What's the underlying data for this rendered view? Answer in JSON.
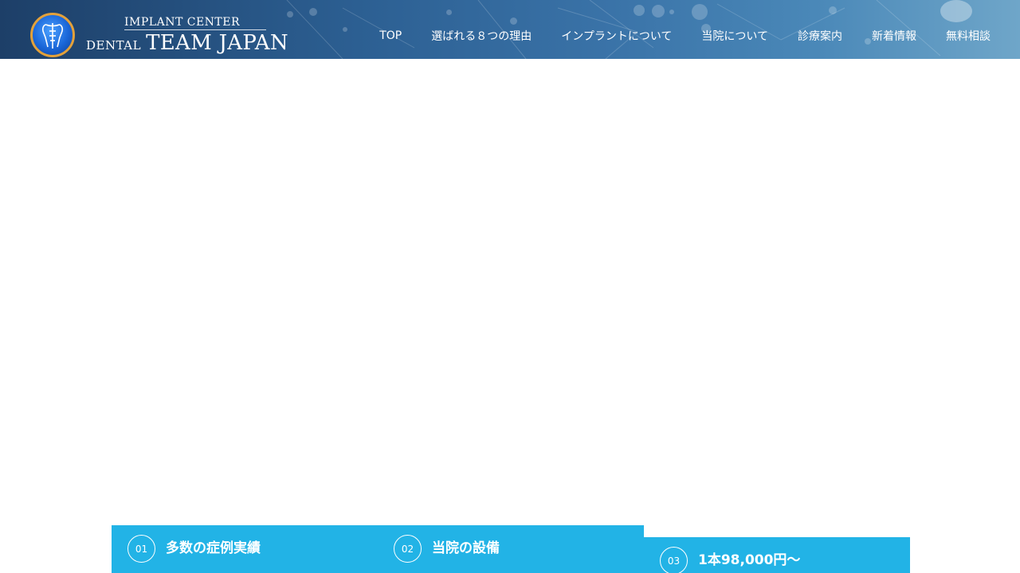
{
  "brand": {
    "small": "IMPLANT CENTER",
    "dental": "DENTAL",
    "name": "TEAM JAPAN",
    "logo_icon": "tooth-implant-emblem-icon"
  },
  "nav": {
    "items": [
      {
        "label": "TOP"
      },
      {
        "label": "選ばれる８つの理由"
      },
      {
        "label": "インプラントについて"
      },
      {
        "label": "当院について"
      },
      {
        "label": "診療案内"
      },
      {
        "label": "新着情報"
      },
      {
        "label": "無料相談"
      }
    ]
  },
  "features": [
    {
      "num": "01",
      "title": "多数の症例実績"
    },
    {
      "num": "02",
      "title": "当院の設備"
    },
    {
      "num": "03",
      "title": "1本98,000円〜"
    }
  ],
  "colors": {
    "accent": "#22b3e6",
    "header": "#2c5f92",
    "logo_ring": "#e3a13a"
  }
}
